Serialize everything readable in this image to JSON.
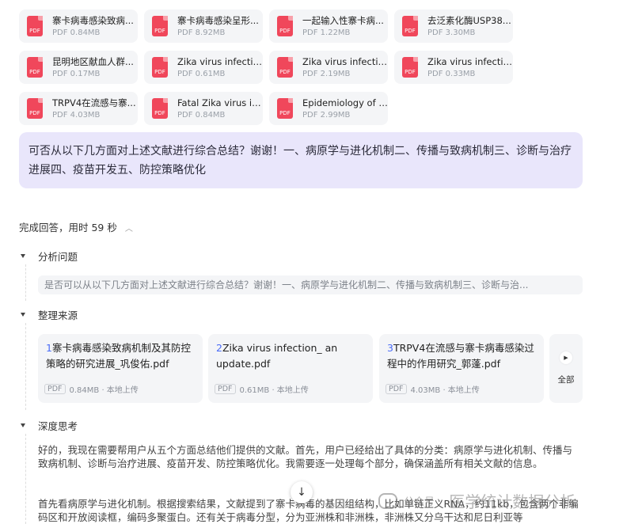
{
  "files": [
    {
      "name": "寨卡病毒感染致病...",
      "size": "PDF  0.84MB"
    },
    {
      "name": "寨卡病毒感染呈形...",
      "size": "PDF  8.92MB"
    },
    {
      "name": "一起输入性寨卡病...",
      "size": "PDF  1.22MB"
    },
    {
      "name": "去泛素化酶USP38...",
      "size": "PDF  3.30MB"
    },
    {
      "name": "昆明地区献血人群...",
      "size": "PDF  0.17MB"
    },
    {
      "name": "Zika virus infection...",
      "size": "PDF  0.61MB"
    },
    {
      "name": "Zika virus infection ...",
      "size": "PDF  2.19MB"
    },
    {
      "name": "Zika virus infection ...",
      "size": "PDF  0.33MB"
    },
    {
      "name": "TRPV4在流感与寨...",
      "size": "PDF  4.03MB"
    },
    {
      "name": "Fatal Zika virus infe...",
      "size": "PDF  0.84MB"
    },
    {
      "name": "Epidemiology of Zi...",
      "size": "PDF  2.99MB"
    }
  ],
  "pdf_icon_label": "PDF",
  "question": "可否从以下几方面对上述文献进行综合总结？谢谢！一、病原学与进化机制二、传播与致病机制三、诊断与治疗进展四、疫苗开发五、防控策略优化",
  "status": "完成回答，用时 59 秒",
  "sections": {
    "analysis": "分析问题",
    "sources": "整理来源",
    "thinking": "深度思考"
  },
  "analysis_text": "是否可以从以下几方面对上述文献进行综合总结？谢谢！一、病原学与进化机制二、传播与致病机制三、诊断与治...",
  "sources": [
    {
      "num": "1",
      "title": "寨卡病毒感染致病机制及其防控策略的研究进展_巩俊佑.pdf",
      "tag": "PDF",
      "meta": "0.84MB · 本地上传"
    },
    {
      "num": "2",
      "title": "Zika virus infection_ an update.pdf",
      "tag": "PDF",
      "meta": "0.61MB · 本地上传"
    },
    {
      "num": "3",
      "title": "TRPV4在流感与寨卡病毒感染过程中的作用研究_郭蓬.pdf",
      "tag": "PDF",
      "meta": "4.03MB · 本地上传"
    }
  ],
  "more_label": "全部",
  "thinking_p1": "好的，我现在需要帮用户从五个方面总结他们提供的文献。首先，用户已经给出了具体的分类：病原学与进化机制、传播与致病机制、诊断与治疗进展、疫苗开发、防控策略优化。我需要逐一处理每个部分，确保涵盖所有相关文献的信息。",
  "thinking_p2": "首先看病原学与进化机制。根据搜索结果，文献提到了寨卡病毒的基因组结构，比如单链正义RNA，约11kb，包含两个非编码区和开放阅读框，编码多聚蛋白。还有关于病毒分型，分为亚洲株和非洲株，非洲株又分乌干达和尼日利亚等",
  "watermark": {
    "small": "公众号 ·",
    "main": "医学统计数据分析"
  }
}
